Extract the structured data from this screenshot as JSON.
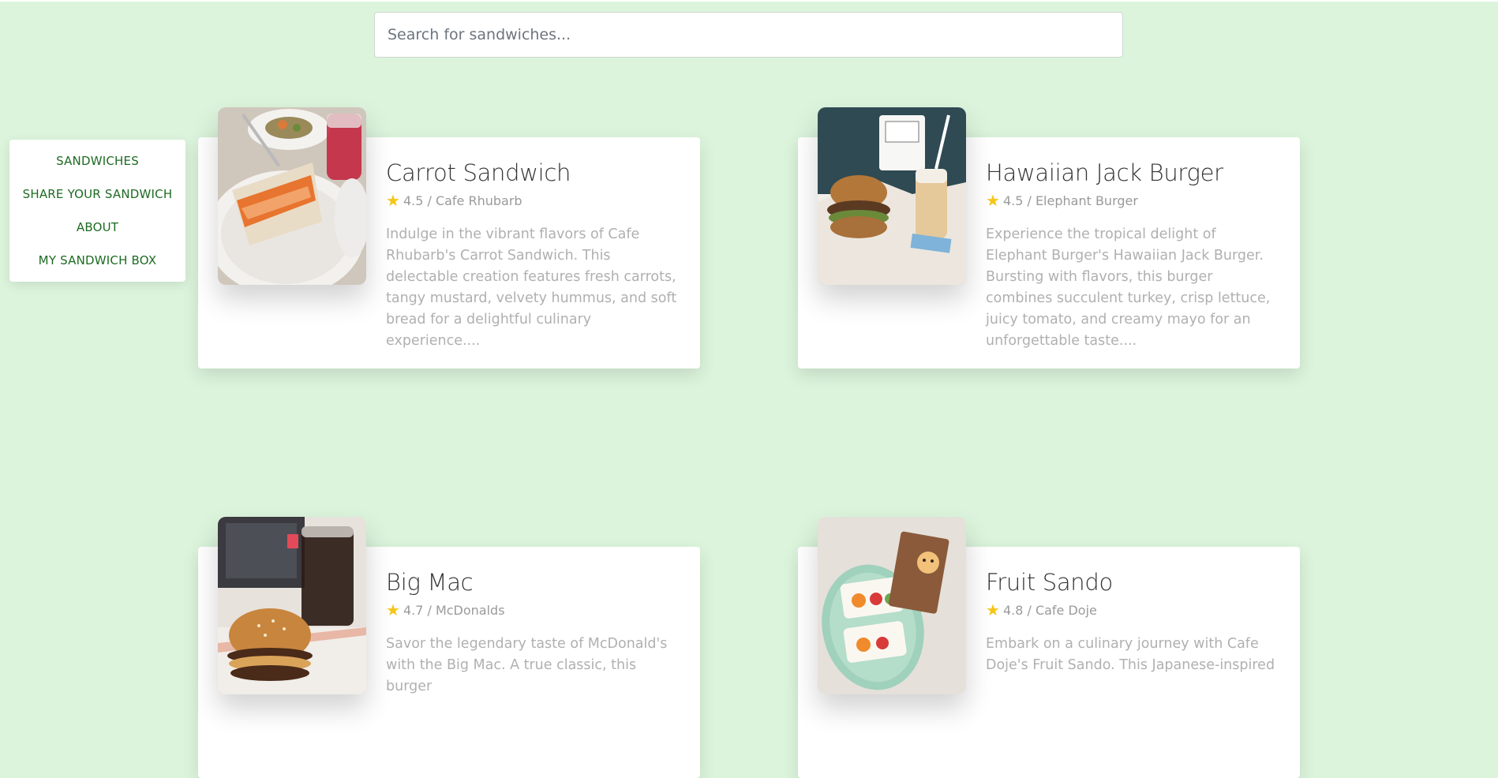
{
  "search": {
    "placeholder": "Search for sandwiches..."
  },
  "nav": {
    "items": [
      {
        "label": "SANDWICHES"
      },
      {
        "label": "SHARE YOUR SANDWICH"
      },
      {
        "label": "ABOUT"
      },
      {
        "label": "MY SANDWICH BOX"
      }
    ]
  },
  "colors": {
    "background": "#dcf4dc",
    "nav_link": "#1d6b22",
    "star": "#f5c518"
  },
  "cards": [
    {
      "title": "Carrot Sandwich",
      "rating": "4.5",
      "place": "Cafe Rhubarb",
      "rating_line": "4.5 / Cafe Rhubarb",
      "description": "Indulge in the vibrant flavors of Cafe Rhubarb's Carrot Sandwich. This delectable creation features fresh carrots, tangy mustard, velvety hummus, and soft bread for a delightful culinary experience...."
    },
    {
      "title": "Hawaiian Jack Burger",
      "rating": "4.5",
      "place": "Elephant Burger",
      "rating_line": "4.5 / Elephant Burger",
      "description": "Experience the tropical delight of Elephant Burger's Hawaiian Jack Burger. Bursting with flavors, this burger combines succulent turkey, crisp lettuce, juicy tomato, and creamy mayo for an unforgettable taste...."
    },
    {
      "title": "Big Mac",
      "rating": "4.7",
      "place": "McDonalds",
      "rating_line": "4.7 / McDonalds",
      "description": "Savor the legendary taste of McDonald's with the Big Mac. A true classic, this burger"
    },
    {
      "title": "Fruit Sando",
      "rating": "4.8",
      "place": "Cafe Doje",
      "rating_line": "4.8 / Cafe Doje",
      "description": "Embark on a culinary journey with Cafe Doje's Fruit Sando. This Japanese-inspired"
    }
  ]
}
